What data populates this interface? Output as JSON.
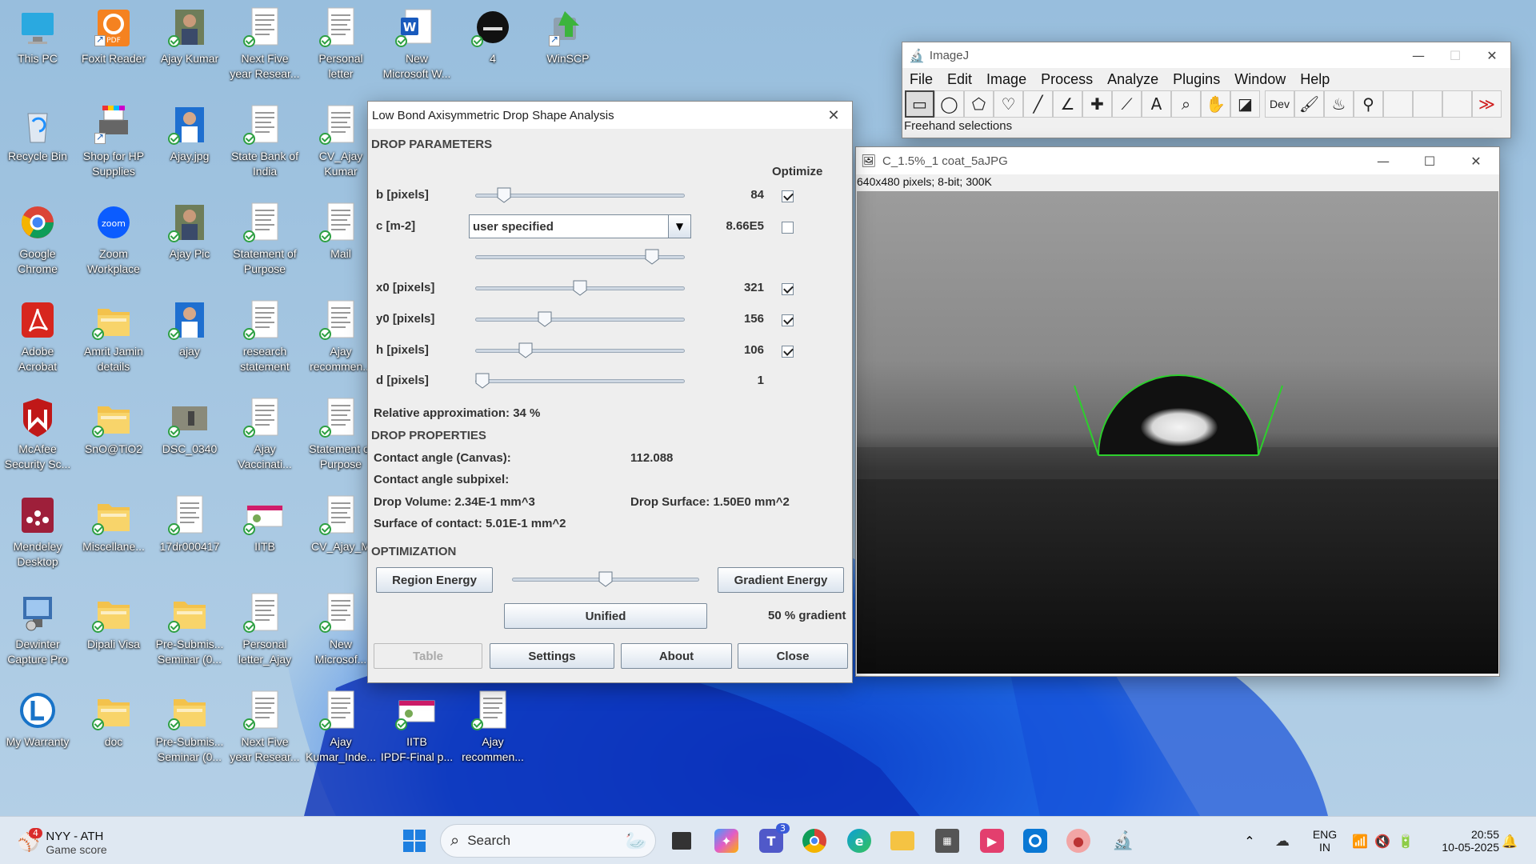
{
  "desktop": {
    "icons": [
      {
        "label": "This PC",
        "kind": "pc"
      },
      {
        "label": "Foxit Reader",
        "kind": "foxit"
      },
      {
        "label": "Ajay Kumar",
        "kind": "photo"
      },
      {
        "label": "Next Five\nyear Resear...",
        "kind": "doc"
      },
      {
        "label": "Personal\nletter",
        "kind": "doc"
      },
      {
        "label": "New\nMicrosoft W...",
        "kind": "word"
      },
      {
        "label": "4",
        "kind": "dark"
      },
      {
        "label": "WinSCP",
        "kind": "winscp"
      },
      {
        "label": "Recycle Bin",
        "kind": "bin"
      },
      {
        "label": "Shop for HP\nSupplies",
        "kind": "printer"
      },
      {
        "label": "Ajay.jpg",
        "kind": "photo2"
      },
      {
        "label": "State Bank of\nIndia",
        "kind": "doc"
      },
      {
        "label": "CV_Ajay\nKumar",
        "kind": "doc"
      },
      {
        "label": "Google\nChrome",
        "kind": "chrome"
      },
      {
        "label": "Zoom\nWorkplace",
        "kind": "zoom"
      },
      {
        "label": "Ajay Pic",
        "kind": "photo"
      },
      {
        "label": "Statement of\nPurpose",
        "kind": "doc"
      },
      {
        "label": "Mail",
        "kind": "doc"
      },
      {
        "label": "Adobe\nAcrobat",
        "kind": "acrobat"
      },
      {
        "label": "Amrit Jamin\ndetails",
        "kind": "folder"
      },
      {
        "label": "ajay",
        "kind": "photo2"
      },
      {
        "label": "research\nstatement",
        "kind": "doc"
      },
      {
        "label": "Ajay\nrecommen...",
        "kind": "doc"
      },
      {
        "label": "McAfee\nSecurity Sc...",
        "kind": "mcafee"
      },
      {
        "label": "SnO@TiO2",
        "kind": "folder"
      },
      {
        "label": "DSC_0340",
        "kind": "photo3"
      },
      {
        "label": "Ajay\nVaccinati...",
        "kind": "doc"
      },
      {
        "label": "Statement of\nPurpose",
        "kind": "doc"
      },
      {
        "label": "Mendeley\nDesktop",
        "kind": "mendeley"
      },
      {
        "label": "Miscellane...",
        "kind": "folder"
      },
      {
        "label": "17dr000417",
        "kind": "doc"
      },
      {
        "label": "IITB",
        "kind": "iitb"
      },
      {
        "label": "CV_Ajay_M",
        "kind": "doc"
      },
      {
        "label": "Dewinter\nCapture Pro",
        "kind": "capture"
      },
      {
        "label": "Dipali Visa",
        "kind": "folder"
      },
      {
        "label": "Pre-Submis...\nSeminar (0...",
        "kind": "folder"
      },
      {
        "label": "Personal\nletter_Ajay",
        "kind": "doc"
      },
      {
        "label": "New\nMicrosof...",
        "kind": "doc"
      },
      {
        "label": "My Warranty",
        "kind": "warranty"
      },
      {
        "label": "doc",
        "kind": "folder"
      },
      {
        "label": "Pre-Submis...\nSeminar (0...",
        "kind": "folder"
      },
      {
        "label": "Next Five\nyear Resear...",
        "kind": "doc"
      },
      {
        "label": "Ajay\nKumar_Inde...",
        "kind": "doc"
      },
      {
        "label": "IITB\nIPDF-Final p...",
        "kind": "iitb"
      },
      {
        "label": "Ajay\nrecommen...",
        "kind": "doc"
      }
    ]
  },
  "lbadsa": {
    "title": "Low Bond Axisymmetric Drop Shape Analysis",
    "close_glyph": "✕",
    "drop_parameters_title": "DROP PARAMETERS",
    "optimize_label": "Optimize",
    "params": [
      {
        "label": "b [pixels]",
        "value": "84",
        "slider": 0.11,
        "checked": true,
        "row": 0
      },
      {
        "label": "c [m-2]",
        "value": "8.66E5",
        "checked": false,
        "row": 1,
        "dropdown": "user specified"
      },
      {
        "label": "",
        "value": "",
        "slider": 0.87,
        "row": 2
      },
      {
        "label": "x0 [pixels]",
        "value": "321",
        "slider": 0.5,
        "checked": true,
        "row": 3
      },
      {
        "label": "y0 [pixels]",
        "value": "156",
        "slider": 0.32,
        "checked": true,
        "row": 4
      },
      {
        "label": "h [pixels]",
        "value": "106",
        "slider": 0.22,
        "checked": true,
        "row": 5
      },
      {
        "label": "d [pixels]",
        "value": "1",
        "slider": 0.0,
        "row": 6
      }
    ],
    "relative_approximation": "Relative approximation: 34 %",
    "drop_properties_title": "DROP PROPERTIES",
    "contact_angle_label": "Contact angle (Canvas):",
    "contact_angle_value": "112.088",
    "contact_angle_subpixel_label": "Contact angle subpixel:",
    "drop_volume": "Drop Volume: 2.34E-1 mm^3",
    "drop_surface": "Drop Surface: 1.50E0 mm^2",
    "surface_of_contact": "Surface of contact: 5.01E-1 mm^2",
    "optimization_title": "OPTIMIZATION",
    "region_energy_button": "Region Energy",
    "gradient_energy_button": "Gradient Energy",
    "optimization_slider": 0.5,
    "unified_button": "Unified",
    "gradient_percent": "50 % gradient",
    "table_button": "Table",
    "settings_button": "Settings",
    "about_button": "About",
    "close_button": "Close"
  },
  "imagej": {
    "title": "ImageJ",
    "menus": [
      "File",
      "Edit",
      "Image",
      "Process",
      "Analyze",
      "Plugins",
      "Window",
      "Help"
    ],
    "tools": [
      "rectangle",
      "oval",
      "polygon",
      "freehand",
      "line",
      "angle",
      "point",
      "wand",
      "text",
      "magnifier",
      "hand",
      "dropper",
      "dev",
      "brush",
      "flood",
      "pickup",
      "blank1",
      "blank2",
      "blank3",
      "more"
    ],
    "dev_label": "Dev",
    "status": "Freehand selections"
  },
  "image_window": {
    "title": "C_1.5%_1 coat_5aJPG",
    "info": "640x480 pixels; 8-bit; 300K"
  },
  "taskbar": {
    "game_title": "NYY - ATH",
    "game_subtitle": "Game score",
    "game_badge": "4",
    "search_placeholder": "Search",
    "teams_badge": "3",
    "lang_top": "ENG",
    "lang_bottom": "IN",
    "time": "20:55",
    "date": "10-05-2025"
  },
  "colors": {
    "accent": "#0067c0",
    "drop_outline": "#2dcf2d",
    "dialog_bg": "#eeeeee"
  }
}
